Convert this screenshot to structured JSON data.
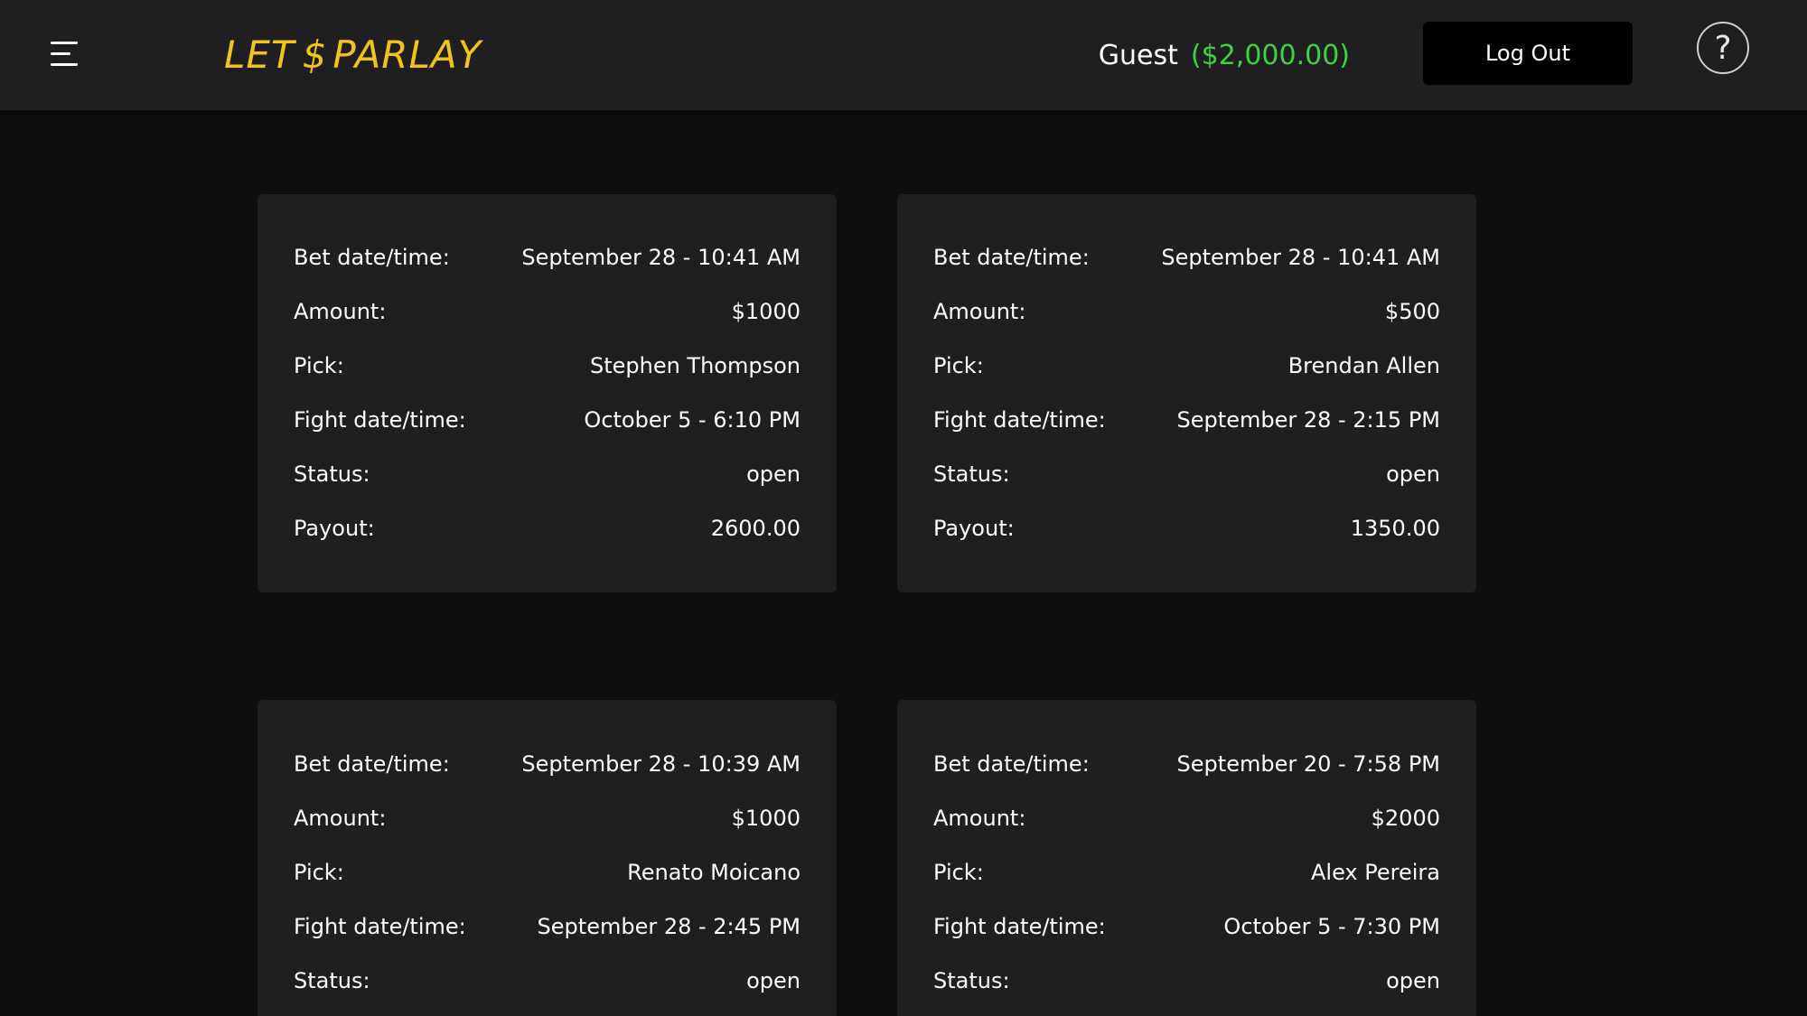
{
  "header": {
    "logo": {
      "left": "LET",
      "symbol": "$",
      "right": "PARLAY"
    },
    "user_name": "Guest",
    "balance": "($2,000.00)",
    "logout_label": "Log Out",
    "help_symbol": "?"
  },
  "labels": {
    "bet_datetime": "Bet date/time:",
    "amount": "Amount:",
    "pick": "Pick:",
    "fight_datetime": "Fight date/time:",
    "status": "Status:",
    "payout": "Payout:"
  },
  "bets": [
    {
      "bet_datetime": "September 28 - 10:41 AM",
      "amount": "$1000",
      "pick": "Stephen Thompson",
      "fight_datetime": "October 5 - 6:10 PM",
      "status": "open",
      "payout": "2600.00"
    },
    {
      "bet_datetime": "September 28 - 10:41 AM",
      "amount": "$500",
      "pick": "Brendan Allen",
      "fight_datetime": "September 28 - 2:15 PM",
      "status": "open",
      "payout": "1350.00"
    },
    {
      "bet_datetime": "September 28 - 10:39 AM",
      "amount": "$1000",
      "pick": "Renato Moicano",
      "fight_datetime": "September 28 - 2:45 PM",
      "status": "open"
    },
    {
      "bet_datetime": "September 20 - 7:58 PM",
      "amount": "$2000",
      "pick": "Alex Pereira",
      "fight_datetime": "October 5 - 7:30 PM",
      "status": "open"
    }
  ]
}
